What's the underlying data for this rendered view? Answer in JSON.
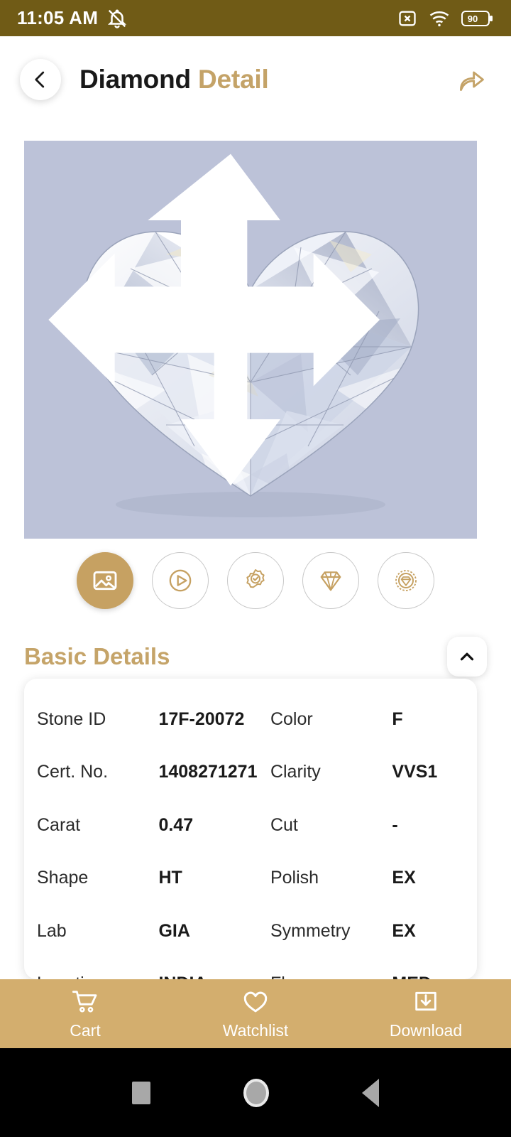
{
  "status_bar": {
    "time": "11:05 AM",
    "bell_icon": "bell-muted-icon",
    "sim_icon": "sim-no-signal-icon",
    "wifi_icon": "wifi-icon",
    "battery_level": "90",
    "background_color": "#705b16"
  },
  "header": {
    "back_icon": "chevron-left-icon",
    "title_primary": "Diamond",
    "title_accent": "Detail",
    "share_icon": "share-arrow-icon",
    "accent_color": "#c4a368"
  },
  "viewer": {
    "media_type": "image",
    "alt": "heart shaped brilliant cut diamond",
    "background_color": "#bcc2d8",
    "expand_icon": "expand-arrows-icon"
  },
  "thumbnails": [
    {
      "name": "image",
      "icon": "image-icon",
      "active": true
    },
    {
      "name": "video",
      "icon": "play-circle-icon",
      "active": false
    },
    {
      "name": "certificate",
      "icon": "certificate-seal-icon",
      "active": false
    },
    {
      "name": "diamond",
      "icon": "diamond-icon",
      "active": false
    },
    {
      "name": "diamond-seal",
      "icon": "diamond-seal-icon",
      "active": false
    }
  ],
  "section": {
    "title": "Basic Details",
    "collapse_icon": "chevron-up-icon",
    "title_color": "#c5a469"
  },
  "details": {
    "rows": [
      {
        "label1": "Stone ID",
        "value1": "17F-20072",
        "label2": "Color",
        "value2": "F"
      },
      {
        "label1": "Cert. No.",
        "value1": "1408271271",
        "label2": "Clarity",
        "value2": "VVS1"
      },
      {
        "label1": "Carat",
        "value1": "0.47",
        "label2": "Cut",
        "value2": "-"
      },
      {
        "label1": "Shape",
        "value1": "HT",
        "label2": "Polish",
        "value2": "EX"
      },
      {
        "label1": "Lab",
        "value1": "GIA",
        "label2": "Symmetry",
        "value2": "EX"
      },
      {
        "label1": "Location",
        "value1": "INDIA",
        "label2": "Fluorescence",
        "value2": "MED"
      }
    ]
  },
  "action_bar": {
    "background_color": "#d3ae6e",
    "items": [
      {
        "label": "Cart",
        "icon": "shopping-cart-icon"
      },
      {
        "label": "Watchlist",
        "icon": "heart-icon"
      },
      {
        "label": "Download",
        "icon": "download-tray-icon"
      }
    ]
  },
  "nav_bar": {
    "recents_icon": "square-icon",
    "home_icon": "circle-icon",
    "back_icon": "triangle-left-icon"
  }
}
